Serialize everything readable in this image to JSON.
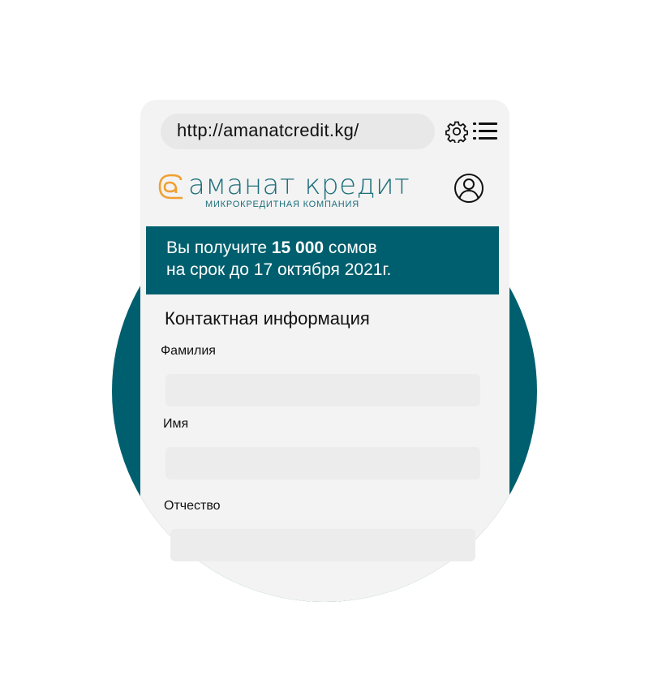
{
  "browser": {
    "url": "http://amanatcredit.kg/"
  },
  "brand": {
    "name": "аманат кредит",
    "tagline": "МИКРОКРЕДИТНАЯ КОМПАНИЯ",
    "accent_color": "#1d6f7b",
    "logo_color": "#f0a030"
  },
  "banner": {
    "line1_prefix": "Вы получите ",
    "line1_amount": "15 000",
    "line1_suffix": " сомов",
    "line2": "на срок до 17 октября 2021г.",
    "bg_color": "#005f6e"
  },
  "form": {
    "section_title": "Контактная информация",
    "fields": [
      {
        "label": "Фамилия",
        "value": ""
      },
      {
        "label": "Имя",
        "value": ""
      },
      {
        "label": "Отчество",
        "value": ""
      }
    ]
  },
  "icons": {
    "settings": "gear-icon",
    "menu": "list-menu-icon",
    "account": "user-account-icon",
    "logo": "amanat-logo-icon"
  }
}
